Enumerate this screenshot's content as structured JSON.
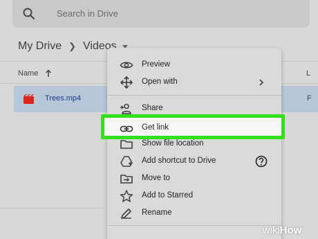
{
  "search": {
    "placeholder": "Search in Drive"
  },
  "breadcrumb": {
    "root": "My Drive",
    "current": "Videos"
  },
  "list": {
    "name_header": "Name",
    "col_l": "L",
    "file": {
      "name": "Trees.mp4",
      "col_value": "F"
    }
  },
  "menu": {
    "items": [
      {
        "label": "Preview",
        "icon": "eye-icon"
      },
      {
        "label": "Open with",
        "icon": "move-arrows-icon",
        "trailing": "chevron-right-icon"
      },
      {
        "label": "Share",
        "icon": "person-add-icon"
      },
      {
        "label": "Get link",
        "icon": "link-icon",
        "highlighted": true
      },
      {
        "label": "Show file location",
        "icon": "folder-icon"
      },
      {
        "label": "Add shortcut to Drive",
        "icon": "drive-shortcut-icon",
        "trailing": "help-icon"
      },
      {
        "label": "Move to",
        "icon": "move-to-icon"
      },
      {
        "label": "Add to Starred",
        "icon": "star-icon"
      },
      {
        "label": "Rename",
        "icon": "pencil-icon"
      }
    ]
  },
  "watermark": {
    "prefix": "wiki",
    "suffix": "How"
  },
  "colors": {
    "highlight_border": "#33e01c",
    "selected_row": "#b7c6d9",
    "file_icon": "#d9271e"
  }
}
